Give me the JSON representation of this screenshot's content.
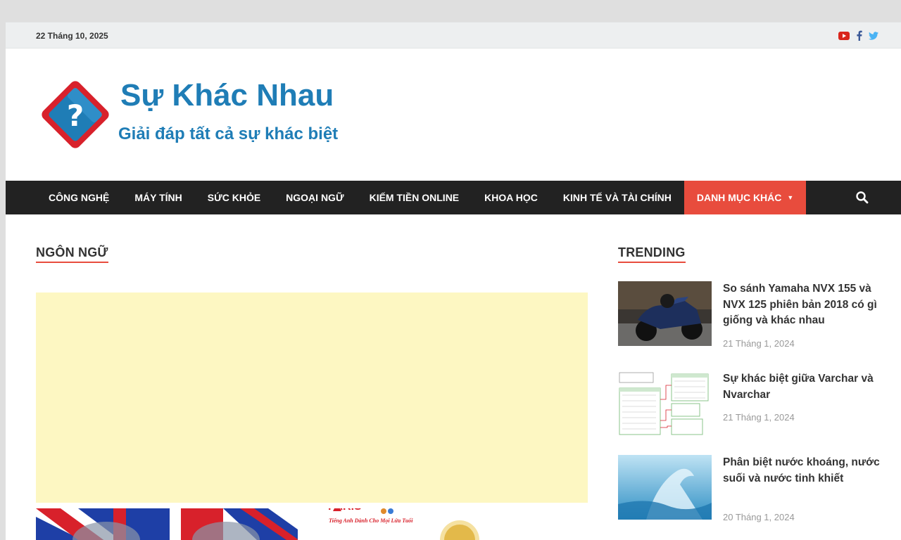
{
  "topbar": {
    "date": "22 Tháng 10, 2025",
    "social_icons": [
      "youtube-icon",
      "facebook-icon",
      "twitter-icon"
    ]
  },
  "header": {
    "logo_title": "Sự Khác Nhau",
    "logo_tagline": "Giải đáp tất cả sự khác biệt"
  },
  "nav": {
    "items": [
      {
        "label": "CÔNG NGHỆ"
      },
      {
        "label": "MÁY TÍNH"
      },
      {
        "label": "SỨC KHỎE"
      },
      {
        "label": "NGOẠI NGỮ"
      },
      {
        "label": "KIẾM TIỀN ONLINE"
      },
      {
        "label": "KHOA HỌC"
      },
      {
        "label": "KINH TẾ VÀ TÀI CHÍNH"
      },
      {
        "label": "DANH MỤC KHÁC",
        "active": true
      }
    ]
  },
  "main": {
    "section_title": "NGÔN NGỮ",
    "thumb_caption": "Tiếng Anh Dành Cho Mọi Lứa Tuổi"
  },
  "sidebar": {
    "title": "TRENDING",
    "posts": [
      {
        "title": "So sánh Yamaha NVX 155 và NVX 125 phiên bản 2018 có gì giống và khác nhau",
        "date": "21 Tháng 1, 2024"
      },
      {
        "title": "Sự khác biệt giữa Varchar và Nvarchar",
        "date": "21 Tháng 1, 2024"
      },
      {
        "title": "Phân biệt nước khoáng, nước suối và nước tinh khiết",
        "date": "20 Tháng 1, 2024"
      }
    ]
  },
  "colors": {
    "accent": "#e84c3d",
    "nav_bg": "#222222",
    "logo_blue": "#1f7db6",
    "ad_bg": "#fdf7c2"
  }
}
